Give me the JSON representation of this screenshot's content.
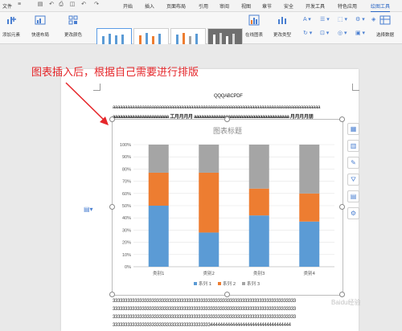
{
  "menubar": {
    "file_label": "文件",
    "tabs": [
      "开始",
      "插入",
      "页面布局",
      "引用",
      "审阅",
      "视图",
      "章节",
      "安全",
      "开发工具",
      "特色应用",
      "绘图工具"
    ]
  },
  "ribbon": {
    "add_element": "添加元素",
    "quick_layout": "快速布局",
    "change_color": "更改颜色",
    "online_chart": "在线图表",
    "change_type": "更改类型",
    "select_data": "选择数据"
  },
  "annotation": "图表插入后，根据自己需要进行排版",
  "document": {
    "heading": "QQQABCPDF",
    "line1": "aaaaaaaaaaaaaaaaaaaaaaaaaaaaaaaaaaaaaaaaaaaaaaaaaaaaaaaaaaaaaaaaaaaaaaaaaaaaaaaaaaaaa",
    "line2": "aaaaaaaaaaaaaaaaaaaaaaa 工月月月月 aaaaaaaaaaaaaaaaaaaaaaaaaaaaaaaaaaaaaaa 月月月月朋",
    "after_lines": [
      "333333333333333333333333333333333333333333333333333333333333333333333333333",
      "333333333333333333333333333333333333333333333333333333333333333333333333333",
      "333333333333333333333333333333333333333333333333333333333333333333333333333",
      "3333333333333333333333333333333333333333444444444444444444444444444444444"
    ]
  },
  "chart_data": {
    "type": "bar",
    "stacked": "percent",
    "title": "图表标题",
    "categories": [
      "类别1",
      "类别2",
      "类别3",
      "类别4"
    ],
    "yticks": [
      "0%",
      "10%",
      "20%",
      "30%",
      "40%",
      "50%",
      "60%",
      "70%",
      "80%",
      "90%",
      "100%"
    ],
    "ylim": [
      0,
      100
    ],
    "series": [
      {
        "name": "系列 1",
        "color": "#5b9bd5",
        "values": [
          50,
          28,
          42,
          37
        ]
      },
      {
        "name": "系列 2",
        "color": "#ed7d31",
        "values": [
          27,
          49,
          22,
          23
        ]
      },
      {
        "name": "系列 3",
        "color": "#a5a5a5",
        "values": [
          23,
          23,
          36,
          40
        ]
      }
    ],
    "legend": "bottom",
    "grid": true
  },
  "colors": {
    "accent": "#2a66c4",
    "annotation": "#e5262a"
  },
  "sidebar_icons": [
    "chart-elements-icon",
    "chart-style-icon",
    "pen-icon",
    "filter-icon",
    "chart-data-icon",
    "settings-icon"
  ],
  "watermark": "Baidu经验"
}
